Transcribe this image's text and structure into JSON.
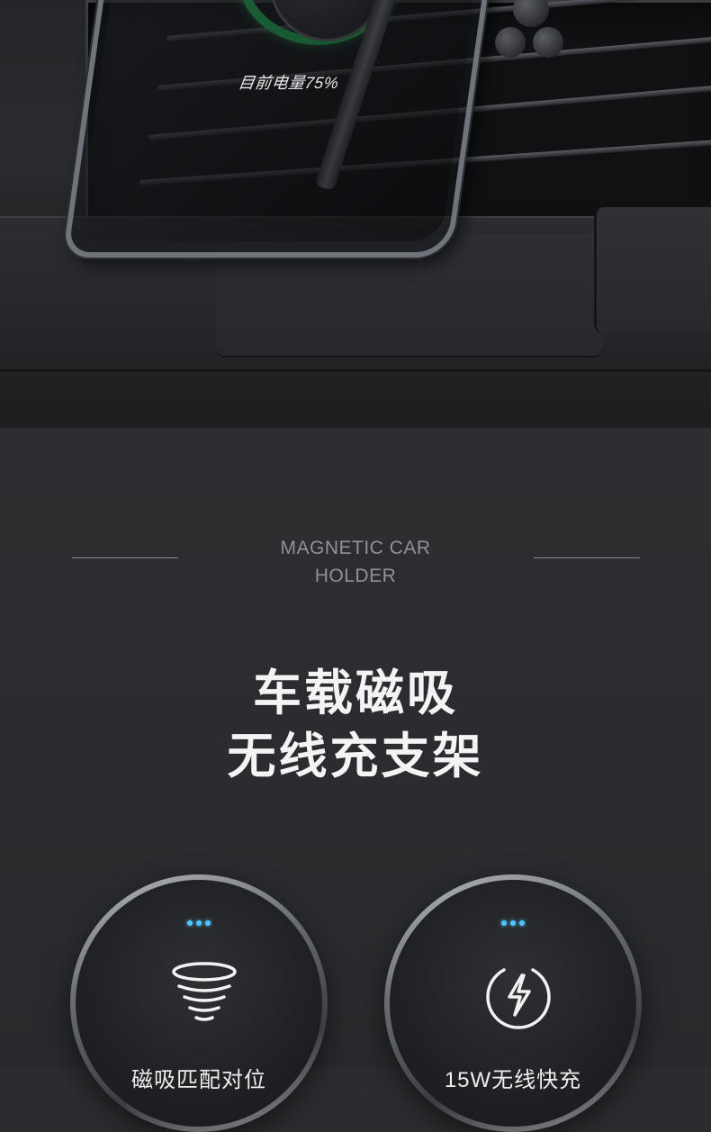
{
  "hero": {
    "battery_text": "目前电量75%",
    "ring_color": "#1ed45f"
  },
  "intro": {
    "subtitle_line1": "MAGNETIC CAR",
    "subtitle_line2": "HOLDER",
    "headline_line1": "车载磁吸",
    "headline_line2": "无线充支架"
  },
  "features": [
    {
      "icon": "magnetic-vortex-icon",
      "label": "磁吸匹配对位",
      "indicator_color": "#4fc6ff"
    },
    {
      "icon": "lightning-bolt-icon",
      "label": "15W无线快充",
      "indicator_color": "#4fc6ff"
    }
  ]
}
